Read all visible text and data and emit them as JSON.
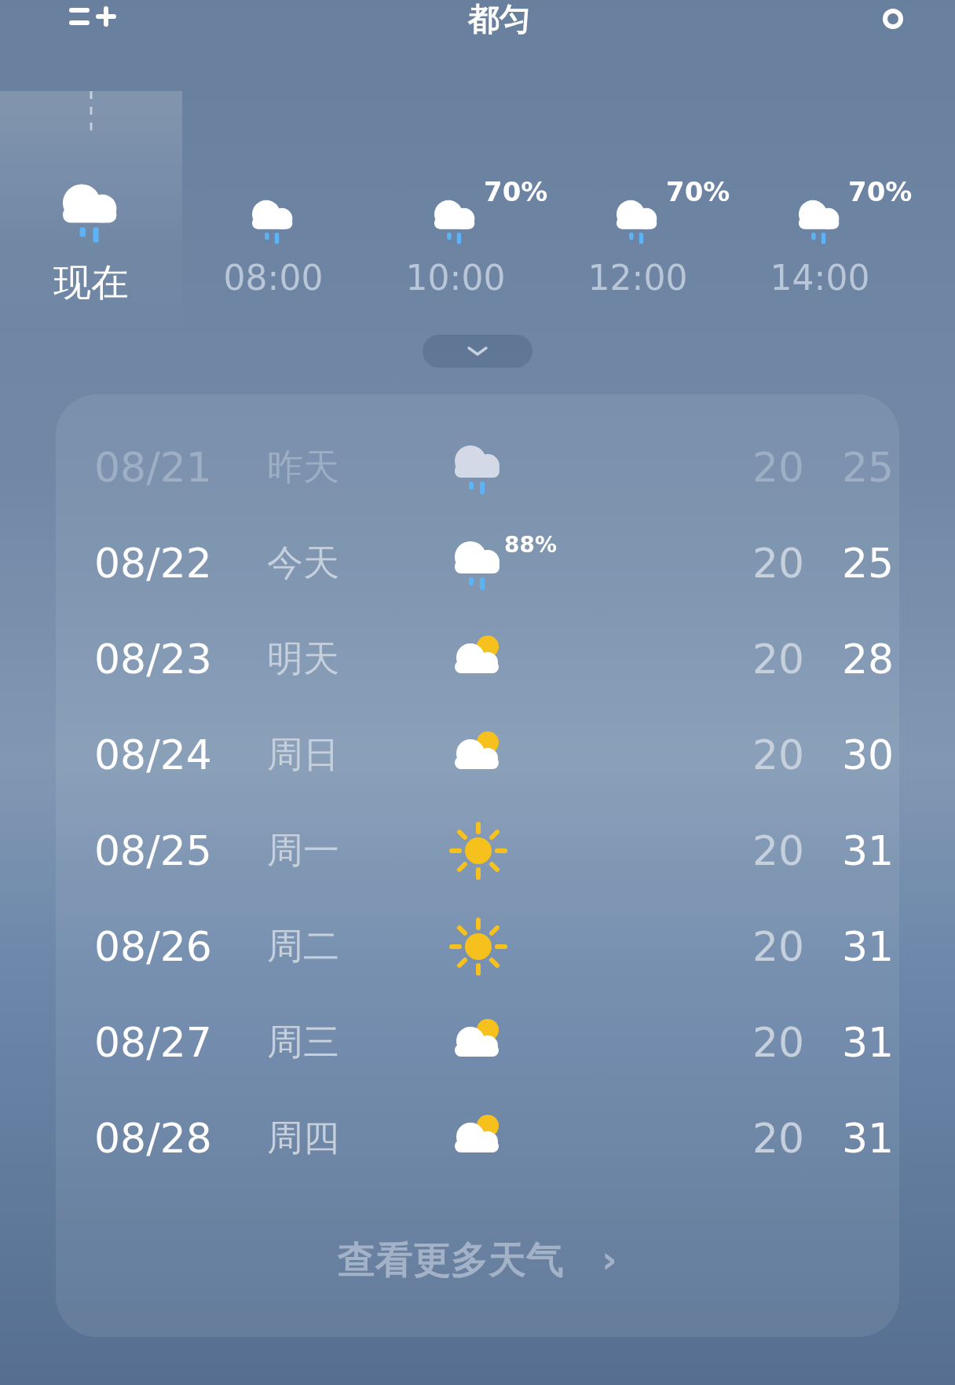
{
  "header": {
    "city": "都匀"
  },
  "hourly": [
    {
      "time": "现在",
      "kind": "rain",
      "selected": true
    },
    {
      "time": "08:00",
      "kind": "rain",
      "selected": false
    },
    {
      "time": "10:00",
      "kind": "rain",
      "precip": "70%",
      "selected": false
    },
    {
      "time": "12:00",
      "kind": "rain",
      "precip": "70%",
      "selected": false
    },
    {
      "time": "14:00",
      "kind": "rain",
      "precip": "70%",
      "selected": false
    }
  ],
  "daily": [
    {
      "date": "08/21",
      "day": "昨天",
      "kind": "rain",
      "low": "20",
      "high": "25",
      "past": true
    },
    {
      "date": "08/22",
      "day": "今天",
      "kind": "rain",
      "precip": "88%",
      "low": "20",
      "high": "25",
      "past": false
    },
    {
      "date": "08/23",
      "day": "明天",
      "kind": "partly-cloudy",
      "low": "20",
      "high": "28",
      "past": false
    },
    {
      "date": "08/24",
      "day": "周日",
      "kind": "partly-cloudy",
      "low": "20",
      "high": "30",
      "past": false
    },
    {
      "date": "08/25",
      "day": "周一",
      "kind": "sunny",
      "low": "20",
      "high": "31",
      "past": false
    },
    {
      "date": "08/26",
      "day": "周二",
      "kind": "sunny",
      "low": "20",
      "high": "31",
      "past": false
    },
    {
      "date": "08/27",
      "day": "周三",
      "kind": "partly-cloudy",
      "low": "20",
      "high": "31",
      "past": false
    },
    {
      "date": "08/28",
      "day": "周四",
      "kind": "partly-cloudy",
      "low": "20",
      "high": "31",
      "past": false
    }
  ],
  "more_link": {
    "label": "查看更多天气",
    "arrow": "›"
  }
}
